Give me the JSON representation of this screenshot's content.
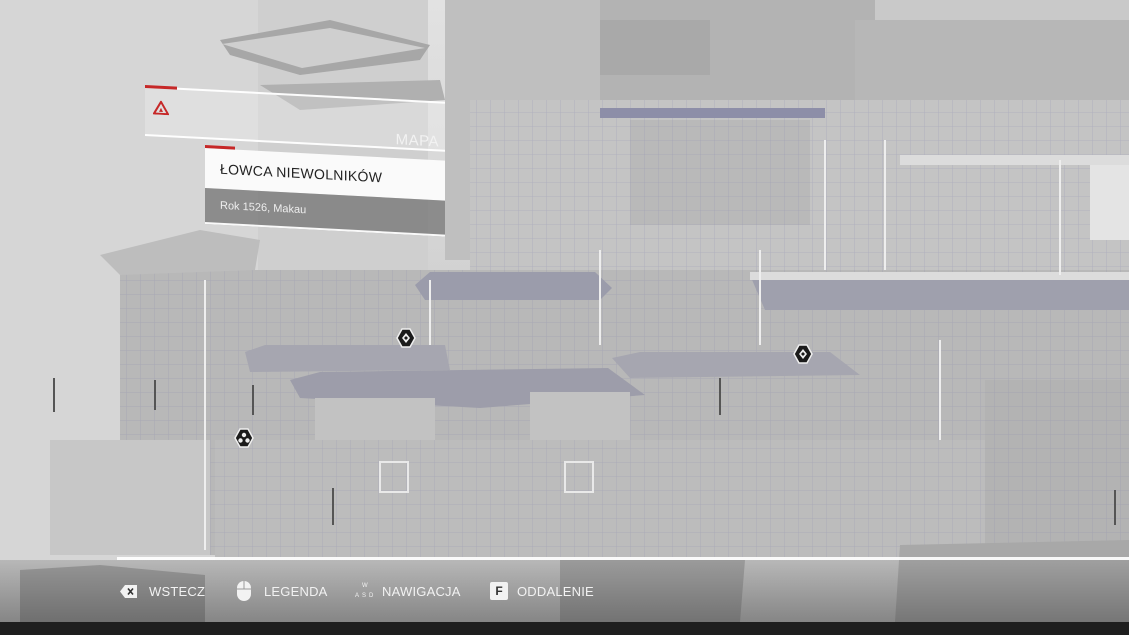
{
  "menu": {
    "title": "MAPA",
    "logo_icon": "assassin-insignia-icon",
    "accent_color": "#c62828"
  },
  "mission": {
    "title": "ŁOWCA NIEWOLNIKÓW",
    "subtitle": "Rok 1526, Makau"
  },
  "map_markers": [
    {
      "icon": "viewpoint-marker-icon"
    },
    {
      "icon": "viewpoint-marker-icon"
    },
    {
      "icon": "treasure-marker-icon"
    }
  ],
  "controls": [
    {
      "icon": "backspace-key-icon",
      "label": "WSTECZ"
    },
    {
      "icon": "mouse-icon",
      "label": "LEGENDA"
    },
    {
      "icon": "wasd-keys-icon",
      "label": "NAWIGACJA",
      "keys": [
        "W",
        "A",
        "S",
        "D"
      ]
    },
    {
      "icon": "f-key-icon",
      "key": "F",
      "label": "ODDALENIE"
    }
  ]
}
